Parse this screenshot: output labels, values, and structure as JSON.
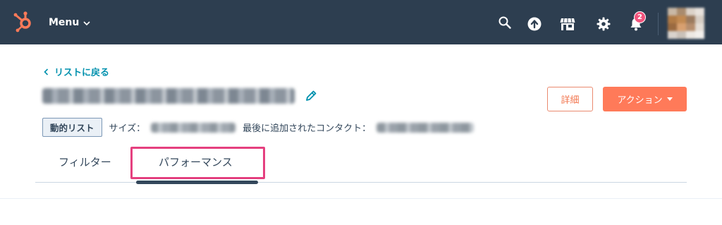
{
  "nav": {
    "menu_label": "Menu",
    "notification_count": "2",
    "icons": [
      "hubspot-sprocket-icon",
      "search-icon",
      "upload-arrow-icon",
      "marketplace-store-icon",
      "settings-gear-icon",
      "notification-bell-icon"
    ],
    "background_color": "#2d3e50"
  },
  "back_link": {
    "label": "リストに戻る"
  },
  "list": {
    "name_redacted": true,
    "type_tag": "動的リスト",
    "size_label": "サイズ：",
    "last_added_label": "最後に追加されたコンタクト："
  },
  "buttons": {
    "detail_label": "詳細",
    "action_label": "アクション"
  },
  "tabs": [
    {
      "label": "フィルター",
      "active": false
    },
    {
      "label": "パフォーマンス",
      "active": true,
      "highlighted": true
    }
  ],
  "colors": {
    "accent_orange": "#ff7a59",
    "link_teal": "#0091ae",
    "highlight_pink": "#e5407f",
    "badge_pink": "#f2547d"
  }
}
